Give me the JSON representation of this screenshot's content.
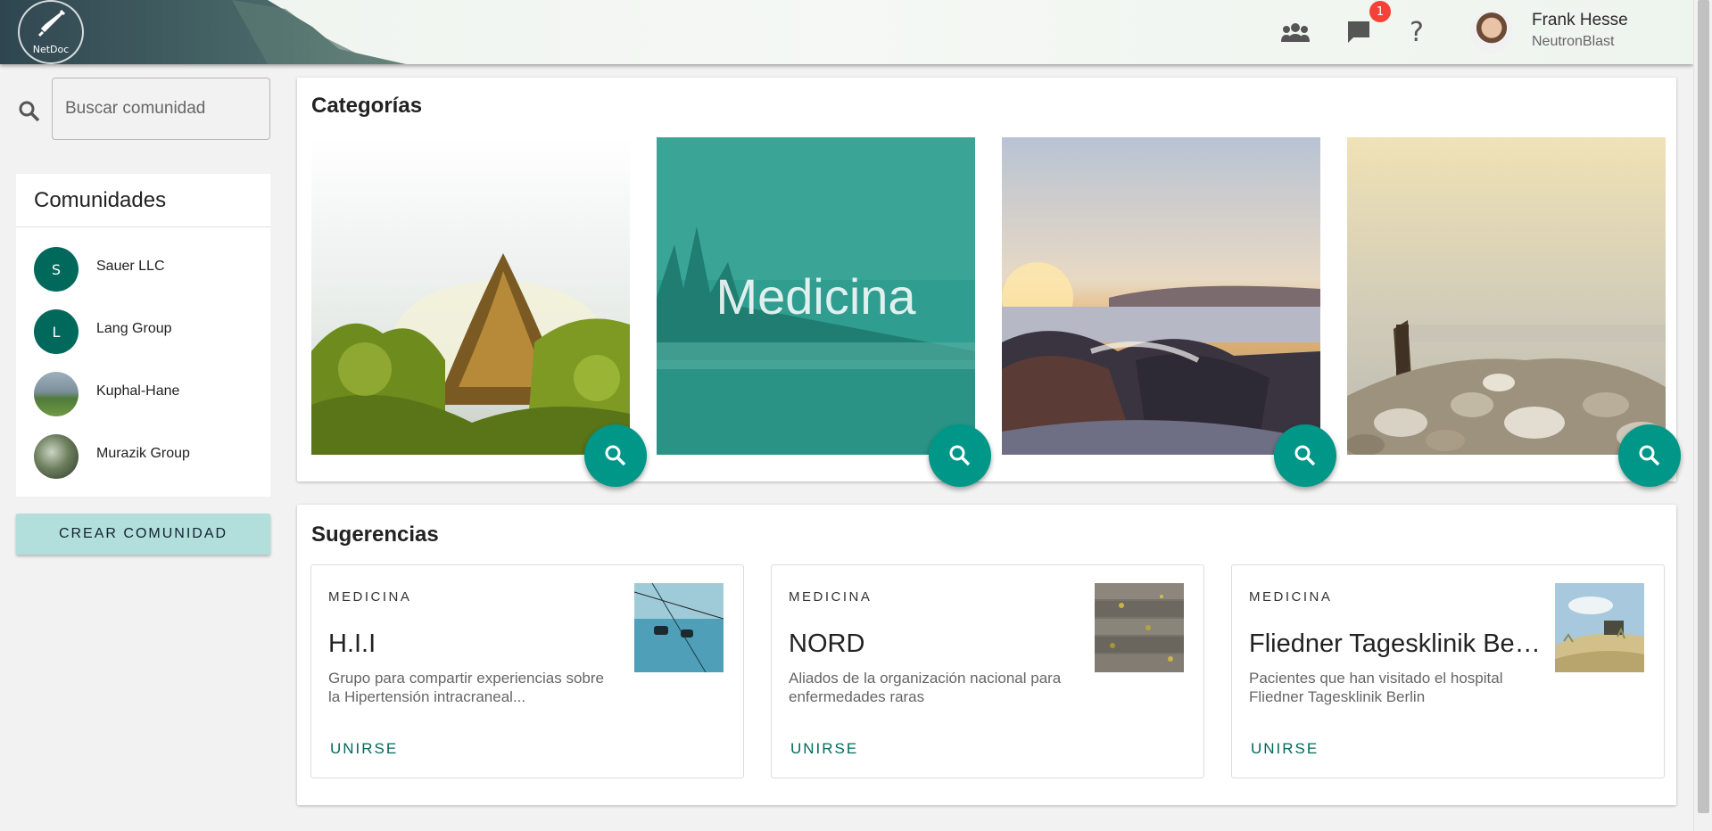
{
  "header": {
    "logo_text": "NetDoc",
    "notifications_count": "1",
    "icons": [
      "groups-icon",
      "chat-icon",
      "help-icon"
    ],
    "user": {
      "name": "Frank Hesse",
      "handle": "NeutronBlast"
    }
  },
  "sidebar": {
    "search_placeholder": "Buscar comunidad",
    "communities_title": "Comunidades",
    "communities": [
      {
        "initial": "S",
        "name": "Sauer LLC"
      },
      {
        "initial": "L",
        "name": "Lang Group"
      },
      {
        "initial": "",
        "name": "Kuphal-Hane"
      },
      {
        "initial": "",
        "name": "Murazik Group"
      }
    ],
    "create_button": "CREAR COMUNIDAD"
  },
  "categories": {
    "title": "Categorías",
    "items": [
      {
        "label": ""
      },
      {
        "label": "Medicina"
      },
      {
        "label": ""
      },
      {
        "label": ""
      }
    ]
  },
  "suggestions": {
    "title": "Sugerencias",
    "items": [
      {
        "category": "MEDICINA",
        "title": "H.I.I",
        "description": "Grupo para compartir experiencias sobre la Hipertensión intracraneal...",
        "action": "UNIRSE"
      },
      {
        "category": "MEDICINA",
        "title": "NORD",
        "description": "Aliados de la organización nacional para enfermedades raras",
        "action": "UNIRSE"
      },
      {
        "category": "MEDICINA",
        "title": "Fliedner Tagesklinik Berlin",
        "description": "Pacientes que han visitado el hospital Fliedner Tagesklinik Berlin",
        "action": "UNIRSE"
      }
    ]
  },
  "colors": {
    "primary": "#009688",
    "primary_dark": "#00695c",
    "accent_light": "#b2dfdb",
    "badge": "#f44336"
  }
}
